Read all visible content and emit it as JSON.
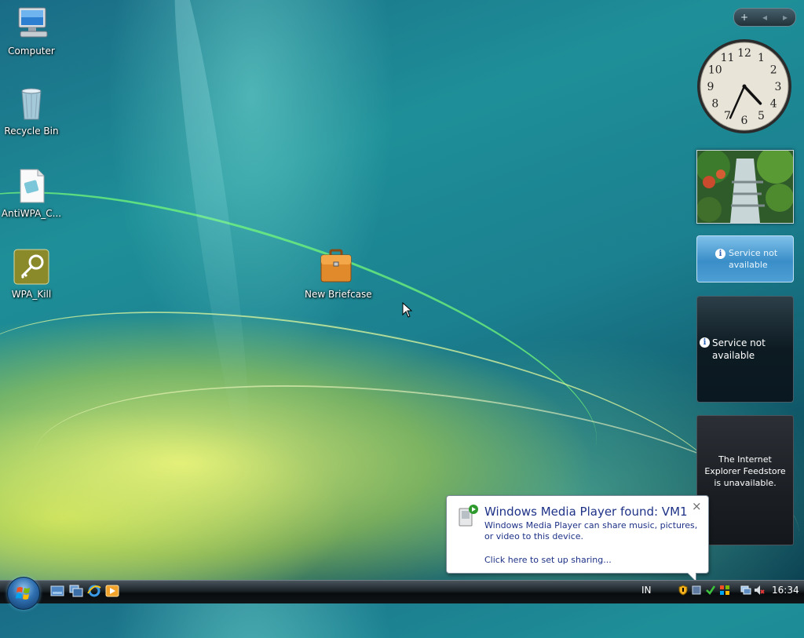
{
  "desktop": {
    "icons": [
      {
        "label": "Computer",
        "icon": "computer-icon"
      },
      {
        "label": "Recycle Bin",
        "icon": "recycle-bin-icon"
      },
      {
        "label": "AntiWPA_C...",
        "icon": "file-icon"
      },
      {
        "label": "WPA_Kill",
        "icon": "key-app-icon"
      },
      {
        "label": "New Briefcase",
        "icon": "briefcase-icon"
      }
    ]
  },
  "sidebar": {
    "controls": {
      "add": "+",
      "prev": "◂",
      "next": "▸"
    },
    "clock": {
      "numerals": [
        "12",
        "1",
        "2",
        "3",
        "4",
        "5",
        "6",
        "7",
        "8",
        "9",
        "10",
        "11"
      ],
      "hour": 4,
      "minute": 34
    },
    "weather": {
      "message": "Service not available"
    },
    "stocks": {
      "message": "Service not available"
    },
    "feeds": {
      "message": "The Internet Explorer Feedstore is unavailable."
    }
  },
  "notification": {
    "title": "Windows Media Player found: VM1",
    "body": "Windows Media Player can share music, pictures, or video to this device.",
    "link": "Click here to set up sharing...",
    "close": "×"
  },
  "taskbar": {
    "quick_launch": [
      "show-desktop-icon",
      "switch-windows-icon",
      "internet-explorer-icon",
      "media-player-icon"
    ],
    "language": "IN",
    "time": "16:34"
  },
  "colors": {
    "accent_text": "#1e3287",
    "taskbar": "#1b2328",
    "desktop": "#1e8f98"
  }
}
